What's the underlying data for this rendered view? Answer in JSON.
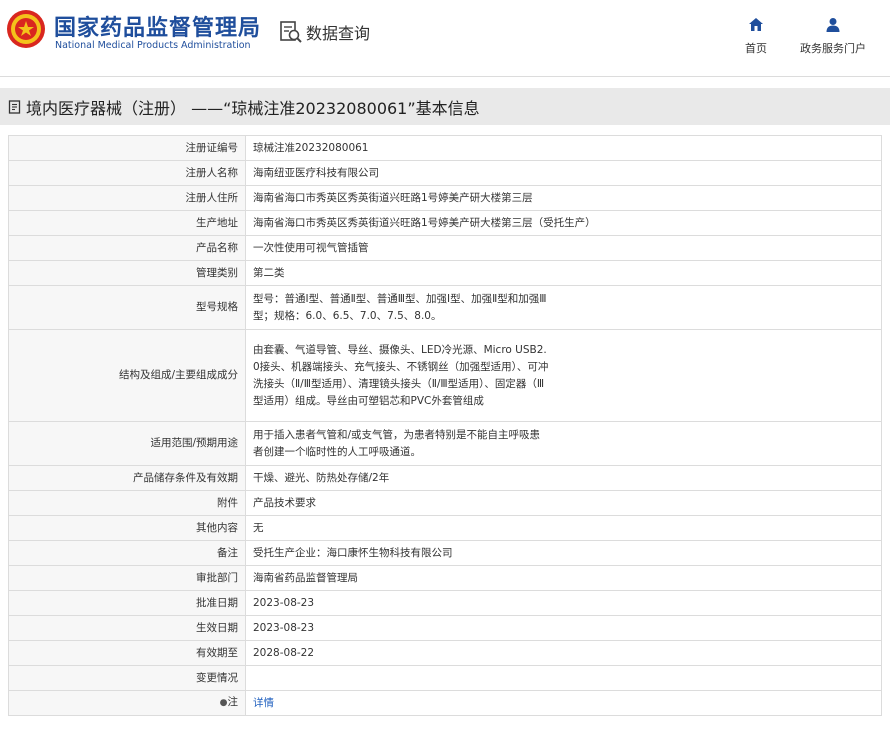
{
  "header": {
    "agency_cn": "国家药品监督管理局",
    "agency_en": "National Medical Products Administration",
    "query_label": "数据查询",
    "nav": [
      {
        "label": "首页",
        "icon": "home-icon"
      },
      {
        "label": "政务服务门户",
        "icon": "user-icon"
      }
    ]
  },
  "title": "境内医疗器械（注册） ——“琼械注准20232080061”基本信息",
  "colors": {
    "brand": "#1f4e9c",
    "link": "#1f5fbf",
    "titlebar_bg": "#e9e9e9",
    "label_bg": "#f7f7f7"
  },
  "rows": [
    {
      "label": "注册证编号",
      "value": "琼械注准20232080061"
    },
    {
      "label": "注册人名称",
      "value": "海南纽亚医疗科技有限公司"
    },
    {
      "label": "注册人住所",
      "value": "海南省海口市秀英区秀英街道兴旺路1号婷美产研大楼第三层"
    },
    {
      "label": "生产地址",
      "value": "海南省海口市秀英区秀英街道兴旺路1号婷美产研大楼第三层（受托生产）"
    },
    {
      "label": "产品名称",
      "value": "一次性使用可视气管插管"
    },
    {
      "label": "管理类别",
      "value": "第二类"
    },
    {
      "label": "型号规格",
      "value": "型号：普通Ⅰ型、普通Ⅱ型、普通Ⅲ型、加强Ⅰ型、加强Ⅱ型和加强Ⅲ型；规格：6.0、6.5、7.0、7.5、8.0。"
    },
    {
      "label": "结构及组成/主要组成成分",
      "value": "由套囊、气道导管、导丝、摄像头、LED冷光源、Micro USB2.0接头、机器端接头、充气接头、不锈钢丝（加强型适用）、可冲洗接头（Ⅱ/Ⅲ型适用）、清理镜头接头（Ⅱ/Ⅲ型适用）、固定器（Ⅲ型适用）组成。导丝由可塑铝芯和PVC外套管组成"
    },
    {
      "label": "适用范围/预期用途",
      "value": "用于插入患者气管和/或支气管，为患者特别是不能自主呼吸患者创建一个临时性的人工呼吸通道。"
    },
    {
      "label": "产品储存条件及有效期",
      "value": "干燥、避光、防热处存储/2年"
    },
    {
      "label": "附件",
      "value": "产品技术要求"
    },
    {
      "label": "其他内容",
      "value": "无"
    },
    {
      "label": "备注",
      "value": "受托生产企业：海口康怀生物科技有限公司"
    },
    {
      "label": "审批部门",
      "value": "海南省药品监督管理局"
    },
    {
      "label": "批准日期",
      "value": "2023-08-23"
    },
    {
      "label": "生效日期",
      "value": "2023-08-23"
    },
    {
      "label": "有效期至",
      "value": "2028-08-22"
    },
    {
      "label": "变更情况",
      "value": ""
    },
    {
      "label": "注",
      "value": "详情",
      "label_prefix": "●"
    }
  ]
}
